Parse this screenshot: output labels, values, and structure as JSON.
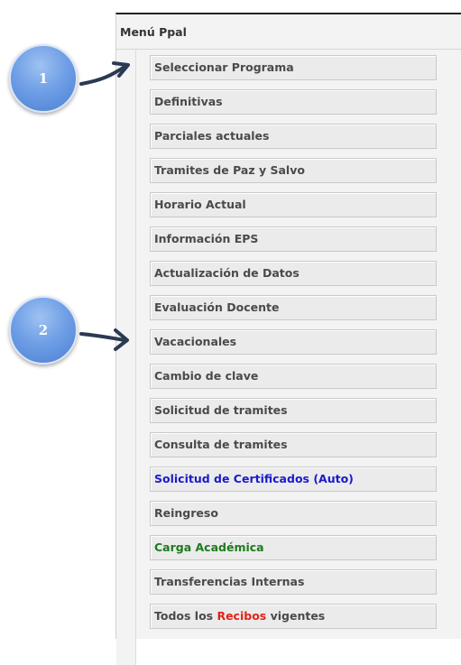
{
  "menu": {
    "title": "Menú Ppal",
    "items": [
      {
        "label": "Seleccionar Programa",
        "color": "#4a4a4a"
      },
      {
        "label": "Definitivas",
        "color": "#4a4a4a"
      },
      {
        "label": "Parciales actuales",
        "color": "#4a4a4a"
      },
      {
        "label": "Tramites de Paz y Salvo",
        "color": "#4a4a4a"
      },
      {
        "label": "Horario Actual",
        "color": "#4a4a4a"
      },
      {
        "label": "Información EPS",
        "color": "#4a4a4a"
      },
      {
        "label": "Actualización de Datos",
        "color": "#4a4a4a"
      },
      {
        "label": "Evaluación Docente",
        "color": "#4a4a4a"
      },
      {
        "label": "Vacacionales",
        "color": "#4a4a4a"
      },
      {
        "label": "Cambio de clave",
        "color": "#4a4a4a"
      },
      {
        "label": "Solicitud de tramites",
        "color": "#4a4a4a"
      },
      {
        "label": "Consulta de tramites",
        "color": "#4a4a4a"
      },
      {
        "label": "Solicitud de Certificados (Auto)",
        "color": "#1a1acc"
      },
      {
        "label": "Reingreso",
        "color": "#4a4a4a"
      },
      {
        "label": "Carga Académica",
        "color": "#1e7a1e"
      },
      {
        "label": "Transferencias Internas",
        "color": "#4a4a4a"
      },
      {
        "prefix": "Todos los ",
        "highlight": "Recibos",
        "suffix": " vigentes",
        "highlight_color": "#e2231a"
      }
    ]
  },
  "callouts": [
    {
      "number": "1"
    },
    {
      "number": "2"
    }
  ]
}
